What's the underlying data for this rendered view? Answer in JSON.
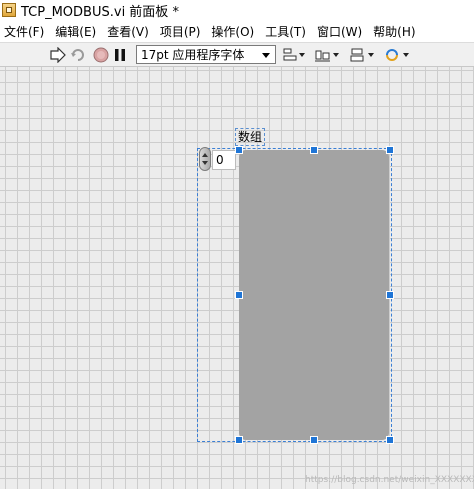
{
  "window": {
    "title": "TCP_MODBUS.vi 前面板 *"
  },
  "menu": {
    "items": [
      {
        "label": "文件(F)"
      },
      {
        "label": "编辑(E)"
      },
      {
        "label": "查看(V)"
      },
      {
        "label": "项目(P)"
      },
      {
        "label": "操作(O)"
      },
      {
        "label": "工具(T)"
      },
      {
        "label": "窗口(W)"
      },
      {
        "label": "帮助(H)"
      }
    ]
  },
  "toolbar": {
    "font_selector": "17pt 应用程序字体",
    "icons": [
      "run-arrow-icon",
      "run-continuously-icon",
      "abort-icon",
      "pause-icon",
      "align-objects-icon",
      "distribute-objects-icon",
      "resize-objects-icon",
      "reorder-icon"
    ]
  },
  "array_control": {
    "label": "数组",
    "index_value": "0"
  },
  "watermark": "https://blog.csdn.net/weixin_XXXXXXXX",
  "colors": {
    "canvas_bg": "#ececec",
    "grid_line": "#cdcdcd",
    "array_body": "#a3a3a3",
    "selection": "#3b7fd4"
  }
}
